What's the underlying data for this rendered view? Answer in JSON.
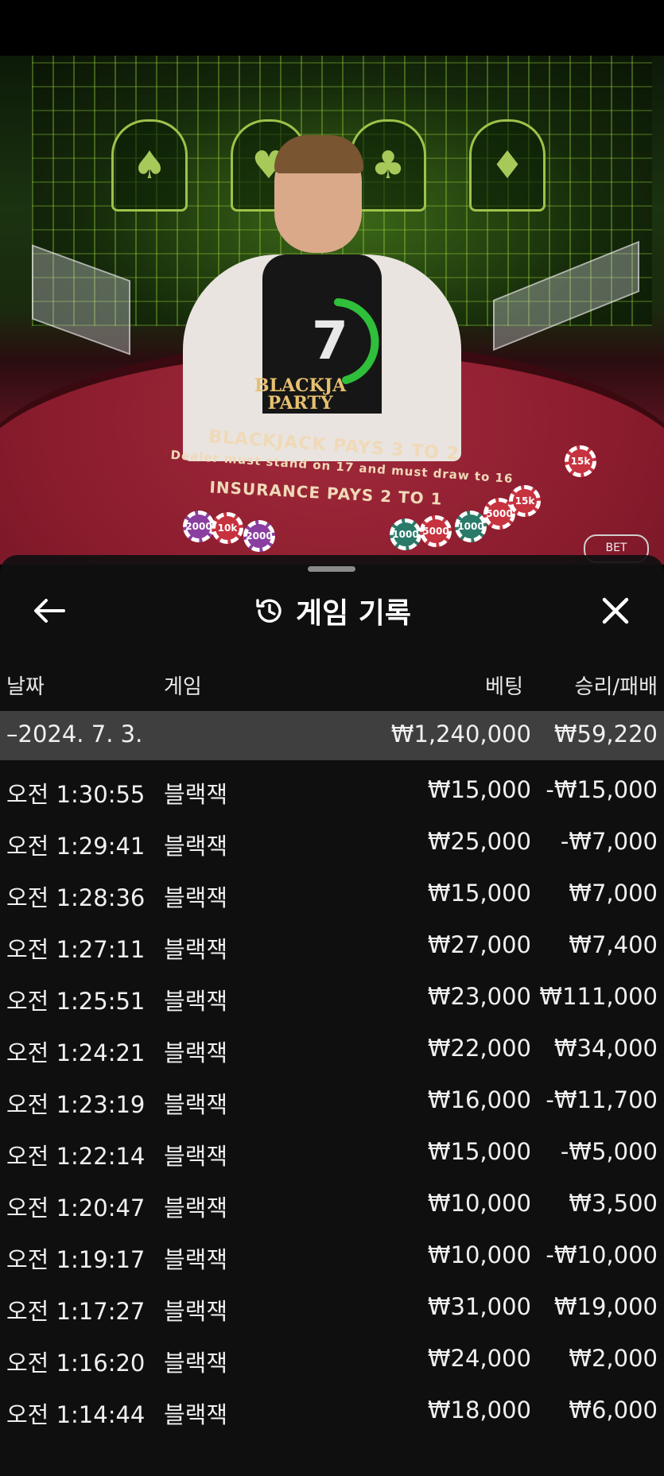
{
  "video": {
    "timer_value": "7",
    "table_logo_line1": "BLACKJA",
    "table_logo_line2": "PARTY",
    "table_line1": "BLACKJACK PAYS 3 TO 2",
    "table_line2": "Dealer must stand on 17 and must draw to 16",
    "table_line3": "INSURANCE PAYS 2 TO 1",
    "chips": [
      "2000",
      "10k",
      "2000",
      "1000",
      "5000",
      "1000",
      "5000",
      "15k",
      "15k"
    ],
    "bet_label": "BET"
  },
  "history": {
    "title": "게임 기록",
    "back_icon": "arrow-left-icon",
    "title_icon": "history-clock-icon",
    "close_icon": "close-x-icon",
    "columns": {
      "date": "날짜",
      "game": "게임",
      "bet": "베팅",
      "win_loss": "승리/패배"
    },
    "date_group": {
      "date": "–2024. 7. 3.",
      "total_bet": "₩1,240,000",
      "total_result": "₩59,220"
    },
    "rows": [
      {
        "time": "오전 1:30:55",
        "game": "블랙잭",
        "bet": "₩15,000",
        "result": "-₩15,000"
      },
      {
        "time": "오전 1:29:41",
        "game": "블랙잭",
        "bet": "₩25,000",
        "result": "-₩7,000"
      },
      {
        "time": "오전 1:28:36",
        "game": "블랙잭",
        "bet": "₩15,000",
        "result": "₩7,000"
      },
      {
        "time": "오전 1:27:11",
        "game": "블랙잭",
        "bet": "₩27,000",
        "result": "₩7,400"
      },
      {
        "time": "오전 1:25:51",
        "game": "블랙잭",
        "bet": "₩23,000",
        "result": "₩111,000"
      },
      {
        "time": "오전 1:24:21",
        "game": "블랙잭",
        "bet": "₩22,000",
        "result": "₩34,000"
      },
      {
        "time": "오전 1:23:19",
        "game": "블랙잭",
        "bet": "₩16,000",
        "result": "-₩11,700"
      },
      {
        "time": "오전 1:22:14",
        "game": "블랙잭",
        "bet": "₩15,000",
        "result": "-₩5,000"
      },
      {
        "time": "오전 1:20:47",
        "game": "블랙잭",
        "bet": "₩10,000",
        "result": "₩3,500"
      },
      {
        "time": "오전 1:19:17",
        "game": "블랙잭",
        "bet": "₩10,000",
        "result": "-₩10,000"
      },
      {
        "time": "오전 1:17:27",
        "game": "블랙잭",
        "bet": "₩31,000",
        "result": "₩19,000"
      },
      {
        "time": "오전 1:16:20",
        "game": "블랙잭",
        "bet": "₩24,000",
        "result": "₩2,000"
      },
      {
        "time": "오전 1:14:44",
        "game": "블랙잭",
        "bet": "₩18,000",
        "result": "₩6,000"
      }
    ]
  },
  "colors": {
    "table": "#8a1c2d",
    "sheet": "#101010",
    "date_row": "#3f3f3f",
    "timer": "#2fbf3a"
  }
}
